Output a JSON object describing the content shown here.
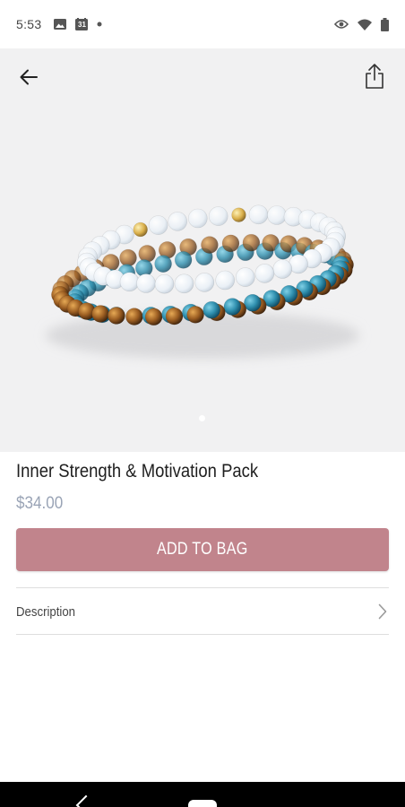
{
  "status_bar": {
    "time": "5:53",
    "left_icons": [
      "image-icon",
      "calendar-icon",
      "dot-icon"
    ],
    "calendar_day": "31",
    "right_icons": [
      "eye-icon",
      "wifi-icon",
      "battery-icon"
    ]
  },
  "hero": {
    "back_icon": "arrow-left-icon",
    "share_icon": "share-icon",
    "image_subject": "bracelets-image",
    "pager": {
      "current": 1,
      "total": 1
    }
  },
  "product": {
    "title": "Inner Strength & Motivation Pack",
    "price": "$34.00"
  },
  "actions": {
    "add_to_bag_label": "ADD TO BAG"
  },
  "description": {
    "label": "Description",
    "chevron_icon": "chevron-right-icon"
  },
  "colors": {
    "accent": "#c1848c",
    "price": "#9aa4b6",
    "hero_bg": "#f1f1f2"
  }
}
